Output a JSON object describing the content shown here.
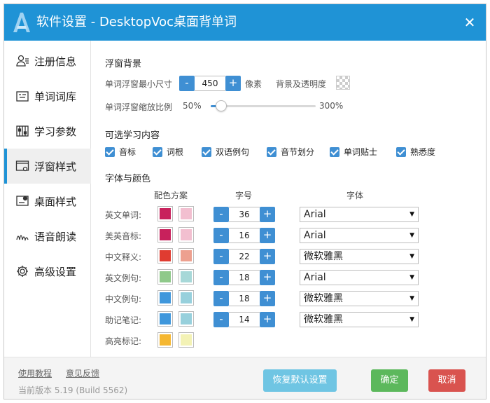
{
  "window": {
    "title": "软件设置 - DesktopVoc桌面背单词",
    "close_glyph": "✕"
  },
  "sidebar": {
    "items": [
      {
        "label": "注册信息",
        "icon": "user-icon"
      },
      {
        "label": "单词词库",
        "icon": "wordbook-icon"
      },
      {
        "label": "学习参数",
        "icon": "params-icon"
      },
      {
        "label": "浮窗样式",
        "icon": "float-window-icon",
        "active": true
      },
      {
        "label": "桌面样式",
        "icon": "desktop-icon"
      },
      {
        "label": "语音朗读",
        "icon": "voice-icon"
      },
      {
        "label": "高级设置",
        "icon": "gear-icon"
      }
    ]
  },
  "float_bg": {
    "title": "浮窗背景",
    "min_size_label": "单词浮窗最小尺寸",
    "min_size_value": "450",
    "min_size_unit": "像素",
    "bg_label": "背景及透明度",
    "scale_label": "单词浮窗缩放比例",
    "scale_min": "50%",
    "scale_max": "300%",
    "scale_fraction": 0.1
  },
  "content_opts": {
    "title": "可选学习内容",
    "items": [
      "音标",
      "词根",
      "双语例句",
      "音节划分",
      "单词贴士",
      "熟悉度"
    ]
  },
  "fonts": {
    "title": "字体与颜色",
    "col_colors": "配色方案",
    "col_size": "字号",
    "col_font": "字体",
    "rows": [
      {
        "label": "英文单词:",
        "c1": "#c8215c",
        "c2": "#f2bfd0",
        "size": "36",
        "font": "Arial"
      },
      {
        "label": "美英音标:",
        "c1": "#c8215c",
        "c2": "#f2bfd0",
        "size": "16",
        "font": "Arial"
      },
      {
        "label": "中文释义:",
        "c1": "#e03c31",
        "c2": "#eda08f",
        "size": "22",
        "font": "微软雅黑"
      },
      {
        "label": "英文例句:",
        "c1": "#8fc98a",
        "c2": "#a7d8d8",
        "size": "18",
        "font": "Arial"
      },
      {
        "label": "中文例句:",
        "c1": "#3f97dc",
        "c2": "#97d0dc",
        "size": "18",
        "font": "微软雅黑"
      },
      {
        "label": "助记笔记:",
        "c1": "#3f97dc",
        "c2": "#97d0dc",
        "size": "14",
        "font": "微软雅黑"
      },
      {
        "label": "高亮标记:",
        "c1": "#f5b731",
        "c2": "#f3f2b5"
      }
    ]
  },
  "footer": {
    "tutorial": "使用教程",
    "feedback": "意见反馈",
    "version": "当前版本 5.19 (Build 5562)",
    "reset": "恢复默认设置",
    "ok": "确定",
    "cancel": "取消"
  },
  "colors": {
    "accent": "#1f93d6",
    "reset_btn": "#6fc5e3",
    "ok_btn": "#5cb85c",
    "cancel_btn": "#d9534f"
  }
}
